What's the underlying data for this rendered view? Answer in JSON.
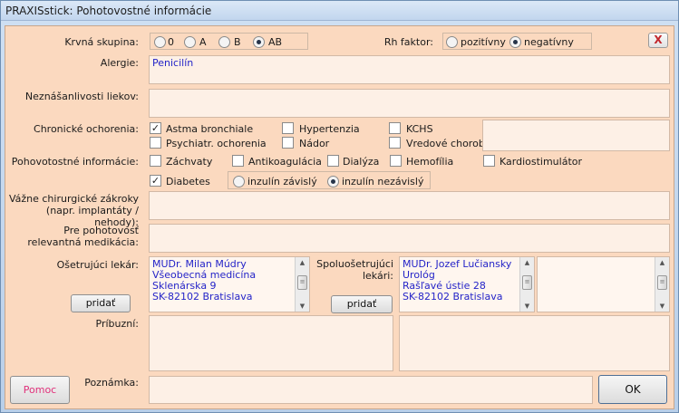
{
  "window": {
    "title": "PRAXISstick: Pohotovostné informácie"
  },
  "blood_group": {
    "label": "Krvná skupina:",
    "options": [
      "0",
      "A",
      "B",
      "AB"
    ],
    "selected": "AB"
  },
  "rh": {
    "label": "Rh faktor:",
    "options": [
      "pozitívny",
      "negatívny"
    ],
    "selected": "negatívny"
  },
  "allergies": {
    "label": "Alergie:",
    "value": "Penicilín"
  },
  "intolerance": {
    "label": "Neznášanlivosti liekov:",
    "value": ""
  },
  "chronic": {
    "label": "Chronické ochorenia:",
    "items": [
      {
        "label": "Astma bronchiale",
        "checked": true
      },
      {
        "label": "Hypertenzia",
        "checked": false
      },
      {
        "label": "KCHS",
        "checked": false
      },
      {
        "label": "Psychiatr. ochorenia",
        "checked": false
      },
      {
        "label": "Nádor",
        "checked": false
      },
      {
        "label": "Vredové choroby",
        "checked": false
      }
    ]
  },
  "emergency": {
    "label": "Pohovotostné informácie:",
    "items": [
      {
        "label": "Záchvaty",
        "checked": false
      },
      {
        "label": "Antikoagulácia",
        "checked": false
      },
      {
        "label": "Dialýza",
        "checked": false
      },
      {
        "label": "Hemofília",
        "checked": false
      },
      {
        "label": "Kardiostimulátor",
        "checked": false
      },
      {
        "label": "Diabetes",
        "checked": true
      }
    ],
    "insulin_options": [
      "inzulín závislý",
      "inzulín nezávislý"
    ],
    "insulin_selected": "inzulín nezávislý"
  },
  "surgery": {
    "label_line1": "Vážne chirurgické zákroky",
    "label_line2": "(napr. implantáty / nehody):",
    "value": ""
  },
  "medication": {
    "label_line1": "Pre pohotovosť",
    "label_line2": "relevantná medikácia:",
    "value": ""
  },
  "doctor": {
    "label": "Ošetrujúci lekár:",
    "lines": [
      "MUDr. Milan Múdry",
      "Všeobecná medicína",
      "Sklenárska 9",
      "SK-82102 Bratislava"
    ],
    "add_label": "pridať"
  },
  "co_doctor": {
    "label_line1": "Spoluošetrujúci",
    "label_line2": "lekári:",
    "lines": [
      "MUDr. Jozef Lučiansky",
      "Urológ",
      "Rašľavé ústie 28",
      "SK-82102 Bratislava"
    ],
    "add_label": "pridať"
  },
  "relatives": {
    "label": "Príbuzní:"
  },
  "note": {
    "label": "Poznámka:",
    "value": ""
  },
  "buttons": {
    "help": "Pomoc",
    "ok": "OK",
    "close": "X"
  },
  "colors": {
    "background": "#fbd9bf",
    "field": "#fdf0e6",
    "value_text": "#2424c8",
    "help_text": "#e0307a",
    "close_x": "#c2272d"
  }
}
